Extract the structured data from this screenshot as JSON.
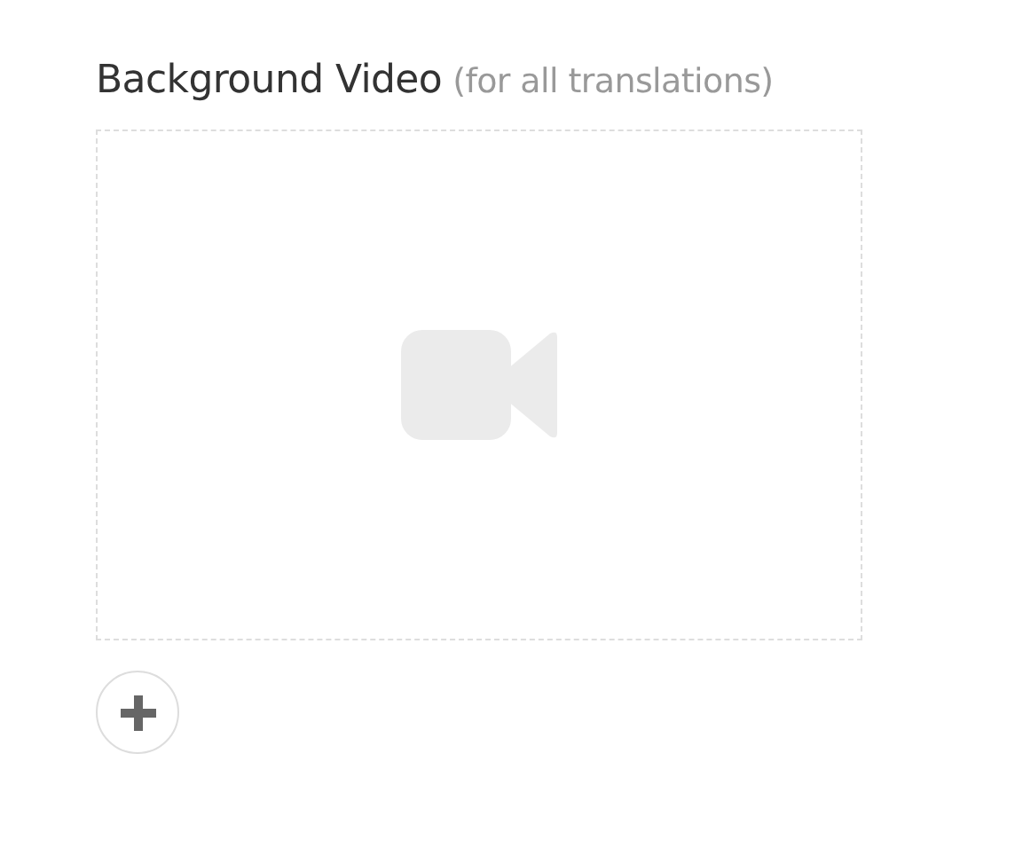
{
  "section": {
    "title": "Background Video",
    "note": "(for all translations)"
  }
}
